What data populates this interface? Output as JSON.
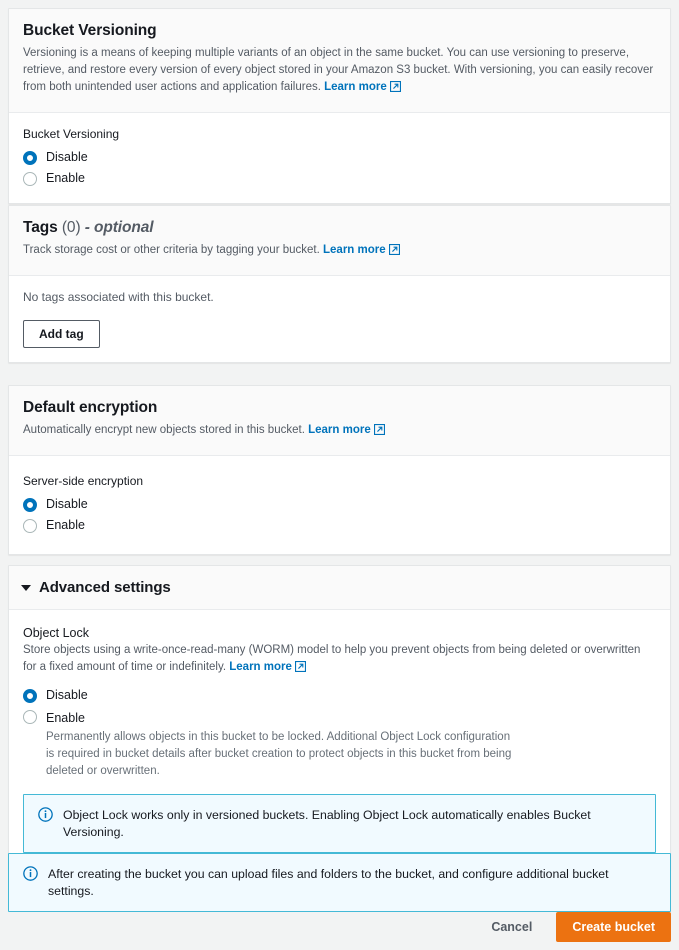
{
  "versioning_card": {
    "title": "Bucket Versioning",
    "description_before_link": "Versioning is a means of keeping multiple variants of an object in the same bucket. You can use versioning to preserve, retrieve, and restore every version of every object stored in your Amazon S3 bucket. With versioning, you can easily recover from both unintended user actions and application failures. ",
    "learn_more": "Learn more",
    "field_label": "Bucket Versioning",
    "options": [
      {
        "label": "Disable",
        "selected": true
      },
      {
        "label": "Enable",
        "selected": false
      }
    ]
  },
  "tags_card": {
    "title": "Tags",
    "count": "(0)",
    "optional": "- optional",
    "description_before_link": "Track storage cost or other criteria by tagging your bucket. ",
    "learn_more": "Learn more",
    "empty_text": "No tags associated with this bucket.",
    "add_tag_label": "Add tag"
  },
  "encryption_card": {
    "title": "Default encryption",
    "description_before_link": "Automatically encrypt new objects stored in this bucket. ",
    "learn_more": "Learn more",
    "field_label": "Server-side encryption",
    "options": [
      {
        "label": "Disable",
        "selected": true
      },
      {
        "label": "Enable",
        "selected": false
      }
    ]
  },
  "advanced_card": {
    "title": "Advanced settings",
    "expanded": true,
    "object_lock": {
      "label": "Object Lock",
      "description_before_link": "Store objects using a write-once-read-many (WORM) model to help you prevent objects from being deleted or overwritten for a fixed amount of time or indefinitely. ",
      "learn_more": "Learn more",
      "options": [
        {
          "label": "Disable",
          "selected": true,
          "sub": ""
        },
        {
          "label": "Enable",
          "selected": false,
          "sub": "Permanently allows objects in this bucket to be locked. Additional Object Lock configuration is required in bucket details after bucket creation to protect objects in this bucket from being deleted or overwritten."
        }
      ],
      "info_alert": "Object Lock works only in versioned buckets. Enabling Object Lock automatically enables Bucket Versioning."
    }
  },
  "bottom_alert": {
    "text": "After creating the bucket you can upload files and folders to the bucket, and configure additional bucket settings."
  },
  "footer": {
    "cancel_label": "Cancel",
    "create_label": "Create bucket"
  },
  "colors": {
    "accent_blue": "#0073bb",
    "primary_orange": "#ec7211",
    "alert_border": "#44b9d6",
    "alert_bg": "#f1faff",
    "page_bg": "#f2f3f3"
  }
}
